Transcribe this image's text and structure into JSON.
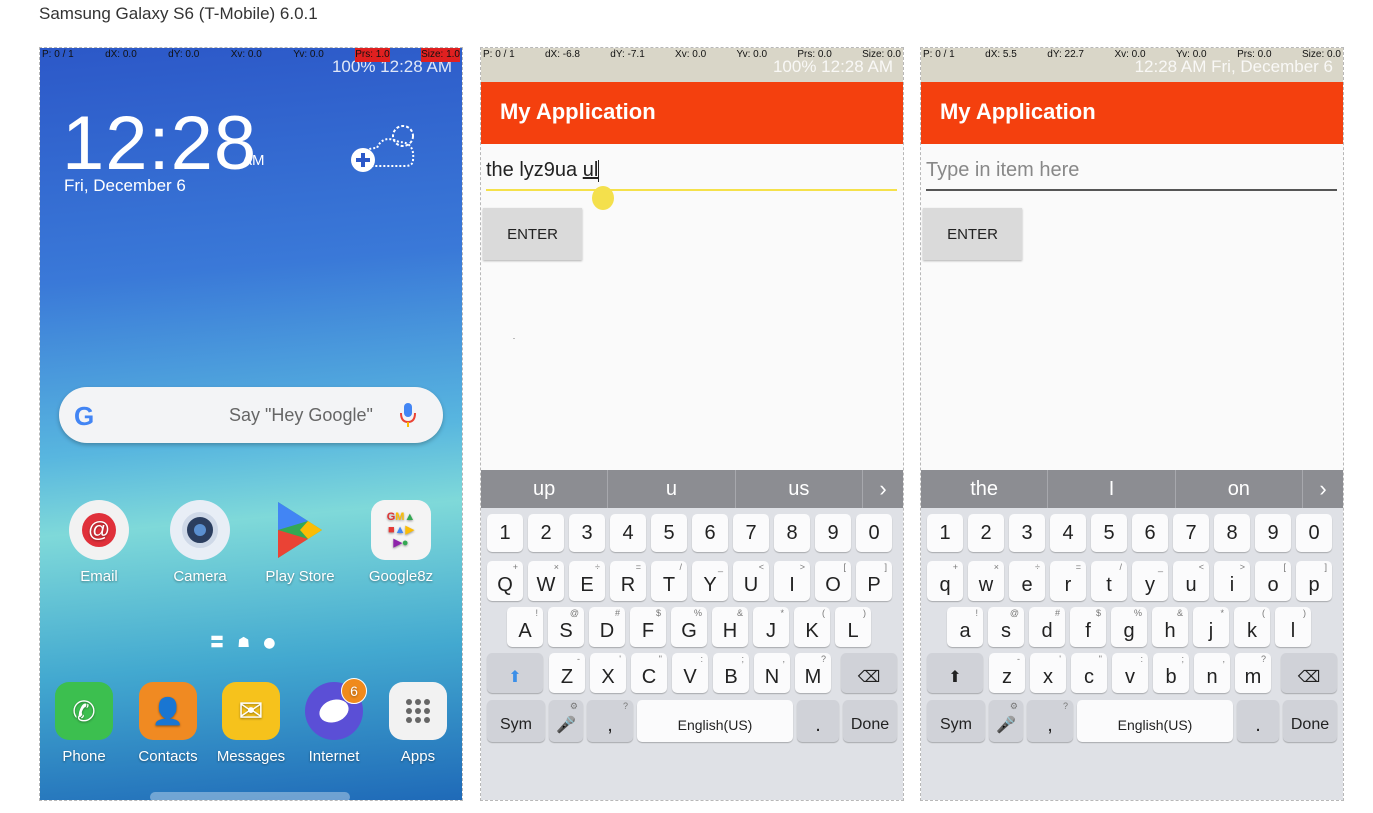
{
  "page_title": "Samsung Galaxy S6 (T-Mobile) 6.0.1",
  "home": {
    "debug": {
      "p": "P: 0 / 1",
      "dx": "dX: 0.0",
      "dy": "dY: 0.0",
      "xv": "Xv: 0.0",
      "yv": "Yv: 0.0",
      "prs": "Prs: 1.0",
      "size": "Size: 1.0"
    },
    "status": "100%  12:28 AM",
    "time": "12:28",
    "ampm": "AM",
    "date": "Fri, December 6",
    "google_placeholder": "Say \"Hey Google\"",
    "apps": [
      {
        "label": "Email",
        "icon": "email-icon"
      },
      {
        "label": "Camera",
        "icon": "camera-icon"
      },
      {
        "label": "Play Store",
        "icon": "play-store-icon"
      },
      {
        "label": "Google8z",
        "icon": "google-folder-icon"
      }
    ],
    "dock": [
      {
        "label": "Phone",
        "icon": "phone-icon"
      },
      {
        "label": "Contacts",
        "icon": "contacts-icon"
      },
      {
        "label": "Messages",
        "icon": "messages-icon"
      },
      {
        "label": "Internet",
        "icon": "internet-icon",
        "badge": "6"
      },
      {
        "label": "Apps",
        "icon": "apps-grid-icon"
      }
    ]
  },
  "app1": {
    "debug": {
      "p": "P: 0 / 1",
      "dx": "dX: -6.8",
      "dy": "dY: -7.1",
      "xv": "Xv: 0.0",
      "yv": "Yv: 0.0",
      "prs": "Prs: 0.0",
      "size": "Size: 0.0"
    },
    "status": "100%  12:28 AM",
    "title": "My Application",
    "input_text": "the lyz9ua ",
    "input_composing": "ul",
    "enter_label": "ENTER",
    "suggestions": [
      "up",
      "u",
      "us"
    ],
    "shift_active": true
  },
  "app2": {
    "debug": {
      "p": "P: 0 / 1",
      "dx": "dX: 5.5",
      "dy": "dY: 22.7",
      "xv": "Xv: 0.0",
      "yv": "Yv: 0.0",
      "prs": "Prs: 0.0",
      "size": "Size: 0.0"
    },
    "status": "12:28 AM Fri, December 6",
    "title": "My Application",
    "input_placeholder": "Type in item here",
    "enter_label": "ENTER",
    "suggestions": [
      "the",
      "I",
      "on"
    ],
    "shift_active": false
  },
  "keyboard": {
    "numbers": [
      "1",
      "2",
      "3",
      "4",
      "5",
      "6",
      "7",
      "8",
      "9",
      "0"
    ],
    "row1": [
      "q",
      "w",
      "e",
      "r",
      "t",
      "y",
      "u",
      "i",
      "o",
      "p"
    ],
    "row1_sub": [
      "+",
      "×",
      "÷",
      "=",
      "/",
      "_",
      "<",
      ">",
      "[",
      "]"
    ],
    "row2": [
      "a",
      "s",
      "d",
      "f",
      "g",
      "h",
      "j",
      "k",
      "l"
    ],
    "row2_sub": [
      "!",
      "@",
      "#",
      "$",
      "%",
      "&",
      "*",
      "(",
      ")"
    ],
    "row3": [
      "z",
      "x",
      "c",
      "v",
      "b",
      "n",
      "m"
    ],
    "row3_sub": [
      "-",
      "'",
      "\"",
      ":",
      ";",
      ",",
      "?"
    ],
    "sym": "Sym",
    "space": "English(US)",
    "period": ".",
    "done": "Done",
    "comma": ","
  }
}
